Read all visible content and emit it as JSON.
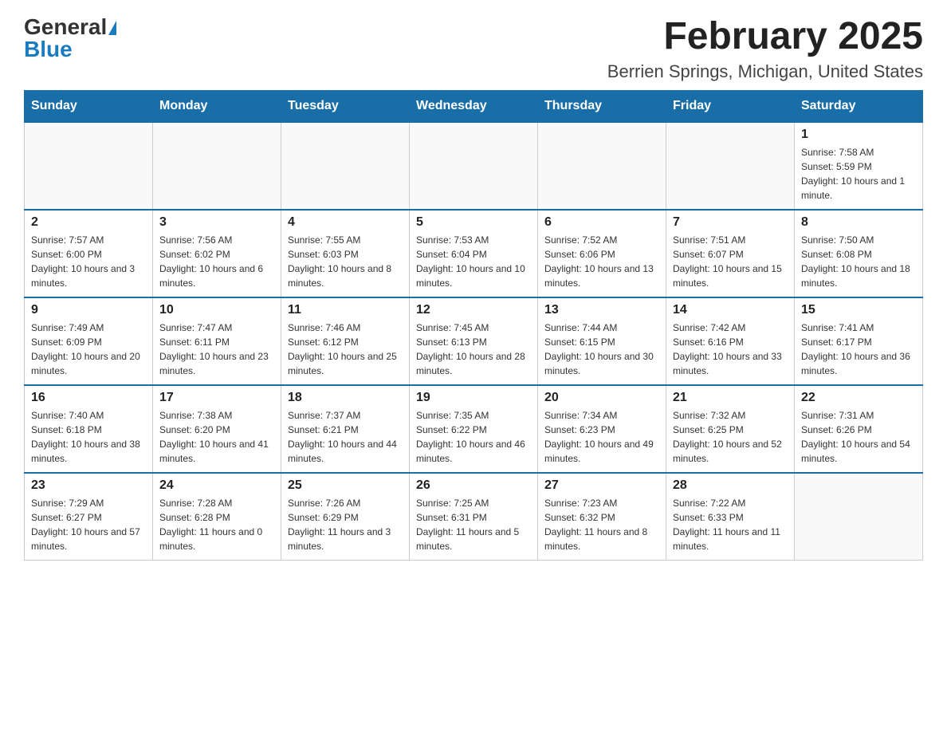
{
  "header": {
    "logo_general": "General",
    "logo_blue": "Blue",
    "month_title": "February 2025",
    "location": "Berrien Springs, Michigan, United States"
  },
  "days_of_week": [
    "Sunday",
    "Monday",
    "Tuesday",
    "Wednesday",
    "Thursday",
    "Friday",
    "Saturday"
  ],
  "weeks": [
    [
      {
        "day": "",
        "info": ""
      },
      {
        "day": "",
        "info": ""
      },
      {
        "day": "",
        "info": ""
      },
      {
        "day": "",
        "info": ""
      },
      {
        "day": "",
        "info": ""
      },
      {
        "day": "",
        "info": ""
      },
      {
        "day": "1",
        "info": "Sunrise: 7:58 AM\nSunset: 5:59 PM\nDaylight: 10 hours and 1 minute."
      }
    ],
    [
      {
        "day": "2",
        "info": "Sunrise: 7:57 AM\nSunset: 6:00 PM\nDaylight: 10 hours and 3 minutes."
      },
      {
        "day": "3",
        "info": "Sunrise: 7:56 AM\nSunset: 6:02 PM\nDaylight: 10 hours and 6 minutes."
      },
      {
        "day": "4",
        "info": "Sunrise: 7:55 AM\nSunset: 6:03 PM\nDaylight: 10 hours and 8 minutes."
      },
      {
        "day": "5",
        "info": "Sunrise: 7:53 AM\nSunset: 6:04 PM\nDaylight: 10 hours and 10 minutes."
      },
      {
        "day": "6",
        "info": "Sunrise: 7:52 AM\nSunset: 6:06 PM\nDaylight: 10 hours and 13 minutes."
      },
      {
        "day": "7",
        "info": "Sunrise: 7:51 AM\nSunset: 6:07 PM\nDaylight: 10 hours and 15 minutes."
      },
      {
        "day": "8",
        "info": "Sunrise: 7:50 AM\nSunset: 6:08 PM\nDaylight: 10 hours and 18 minutes."
      }
    ],
    [
      {
        "day": "9",
        "info": "Sunrise: 7:49 AM\nSunset: 6:09 PM\nDaylight: 10 hours and 20 minutes."
      },
      {
        "day": "10",
        "info": "Sunrise: 7:47 AM\nSunset: 6:11 PM\nDaylight: 10 hours and 23 minutes."
      },
      {
        "day": "11",
        "info": "Sunrise: 7:46 AM\nSunset: 6:12 PM\nDaylight: 10 hours and 25 minutes."
      },
      {
        "day": "12",
        "info": "Sunrise: 7:45 AM\nSunset: 6:13 PM\nDaylight: 10 hours and 28 minutes."
      },
      {
        "day": "13",
        "info": "Sunrise: 7:44 AM\nSunset: 6:15 PM\nDaylight: 10 hours and 30 minutes."
      },
      {
        "day": "14",
        "info": "Sunrise: 7:42 AM\nSunset: 6:16 PM\nDaylight: 10 hours and 33 minutes."
      },
      {
        "day": "15",
        "info": "Sunrise: 7:41 AM\nSunset: 6:17 PM\nDaylight: 10 hours and 36 minutes."
      }
    ],
    [
      {
        "day": "16",
        "info": "Sunrise: 7:40 AM\nSunset: 6:18 PM\nDaylight: 10 hours and 38 minutes."
      },
      {
        "day": "17",
        "info": "Sunrise: 7:38 AM\nSunset: 6:20 PM\nDaylight: 10 hours and 41 minutes."
      },
      {
        "day": "18",
        "info": "Sunrise: 7:37 AM\nSunset: 6:21 PM\nDaylight: 10 hours and 44 minutes."
      },
      {
        "day": "19",
        "info": "Sunrise: 7:35 AM\nSunset: 6:22 PM\nDaylight: 10 hours and 46 minutes."
      },
      {
        "day": "20",
        "info": "Sunrise: 7:34 AM\nSunset: 6:23 PM\nDaylight: 10 hours and 49 minutes."
      },
      {
        "day": "21",
        "info": "Sunrise: 7:32 AM\nSunset: 6:25 PM\nDaylight: 10 hours and 52 minutes."
      },
      {
        "day": "22",
        "info": "Sunrise: 7:31 AM\nSunset: 6:26 PM\nDaylight: 10 hours and 54 minutes."
      }
    ],
    [
      {
        "day": "23",
        "info": "Sunrise: 7:29 AM\nSunset: 6:27 PM\nDaylight: 10 hours and 57 minutes."
      },
      {
        "day": "24",
        "info": "Sunrise: 7:28 AM\nSunset: 6:28 PM\nDaylight: 11 hours and 0 minutes."
      },
      {
        "day": "25",
        "info": "Sunrise: 7:26 AM\nSunset: 6:29 PM\nDaylight: 11 hours and 3 minutes."
      },
      {
        "day": "26",
        "info": "Sunrise: 7:25 AM\nSunset: 6:31 PM\nDaylight: 11 hours and 5 minutes."
      },
      {
        "day": "27",
        "info": "Sunrise: 7:23 AM\nSunset: 6:32 PM\nDaylight: 11 hours and 8 minutes."
      },
      {
        "day": "28",
        "info": "Sunrise: 7:22 AM\nSunset: 6:33 PM\nDaylight: 11 hours and 11 minutes."
      },
      {
        "day": "",
        "info": ""
      }
    ]
  ]
}
